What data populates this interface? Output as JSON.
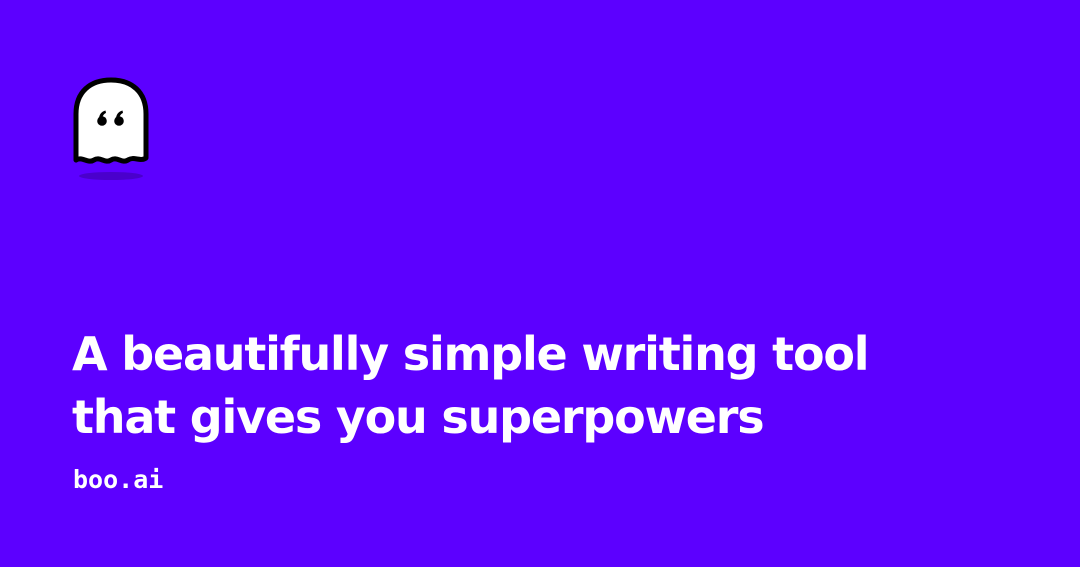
{
  "colors": {
    "background": "#5c00ff",
    "text": "#ffffff",
    "logo_fill": "#ffffff",
    "logo_outline": "#000000",
    "logo_shadow": "#4a00cc"
  },
  "logo": {
    "icon": "ghost-quote-icon"
  },
  "headline": {
    "line1": "A beautifully simple writing tool",
    "line2": "that gives you superpowers"
  },
  "domain": "boo.ai"
}
